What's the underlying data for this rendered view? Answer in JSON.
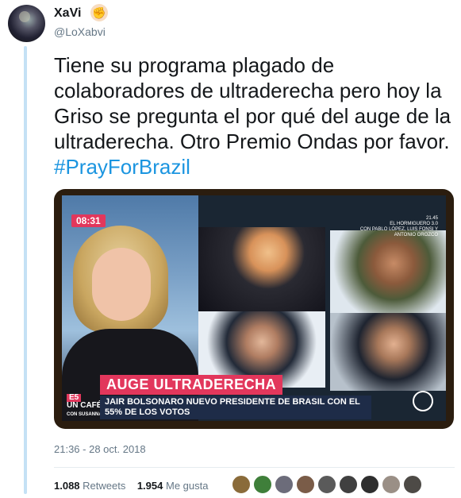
{
  "tweet": {
    "display_name": "XaVi",
    "handle": "@LoXabvi",
    "text": "Tiene su programa plagado de colaboradores de ultraderecha pero hoy la Griso se pregunta el por qué del auge de la ultraderecha. Otro Premio Ondas por favor.",
    "hashtag": "#PrayForBrazil",
    "timestamp": "21:36 - 28 oct. 2018"
  },
  "media": {
    "clock": "08:31",
    "banner_title": "AUGE ULTRADERECHA",
    "banner_line1": "JAIR BOLSONARO NUEVO PRESIDENTE DE BRASIL CON EL",
    "banner_line2": "55% DE LOS VOTOS",
    "show_logo_top": "E5",
    "show_logo_name": "UN CAFÉ",
    "show_logo_sub": "CON SUSANNA",
    "info_time": "21.45",
    "info_show": "EL HORMIGUERO 3.0",
    "info_guests": "CON PABLO LÓPEZ, LUIS FONSI Y ANTONIO OROZCO"
  },
  "stats": {
    "retweets_count": "1.088",
    "retweets_label": "Retweets",
    "likes_count": "1.954",
    "likes_label": "Me gusta"
  },
  "likers": [
    {
      "icon": "avatar",
      "color": "#8a6b3a"
    },
    {
      "icon": "avatar",
      "color": "#3f7f3a"
    },
    {
      "icon": "avatar",
      "color": "#6c6c7a"
    },
    {
      "icon": "avatar",
      "color": "#7a5c48"
    },
    {
      "icon": "avatar",
      "color": "#5a5a5a"
    },
    {
      "icon": "avatar",
      "color": "#404040"
    },
    {
      "icon": "avatar",
      "color": "#2e2e2e"
    },
    {
      "icon": "avatar",
      "color": "#9a8f86"
    },
    {
      "icon": "avatar",
      "color": "#4d4a46"
    }
  ],
  "colors": {
    "hashtag": "#1b95e0",
    "thread_line": "#c4e1f5",
    "banner_red": "#e2375c"
  }
}
